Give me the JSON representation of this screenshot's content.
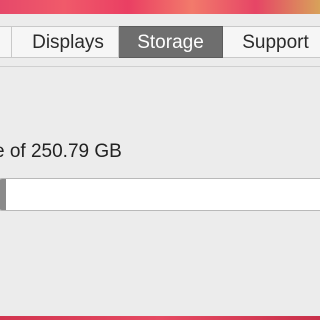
{
  "tabs": {
    "displays": "Displays",
    "storage": "Storage",
    "support": "Support",
    "selected": "Storage"
  },
  "storage": {
    "summary": "e of 250.79 GB",
    "used_fraction": 0.02
  },
  "colors": {
    "selected_tab": "#6e6e6e",
    "bar_fill": "#8a8a8a",
    "wallpaper_accent": "#e6496a"
  }
}
